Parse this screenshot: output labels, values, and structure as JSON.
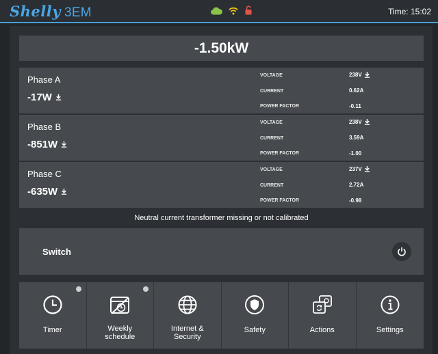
{
  "header": {
    "brand_logo": "Shelly",
    "brand_model": "3EM",
    "time": "Time: 15:02",
    "status_icons": [
      "cloud-icon",
      "wifi-icon",
      "lock-open-icon"
    ],
    "colors": {
      "brand": "#4aa6e6",
      "cloud": "#8bc34a",
      "wifi": "#f5c518",
      "lock": "#e05545"
    }
  },
  "total_power": "-1.50kW",
  "labels": {
    "voltage": "VOLTAGE",
    "current": "CURRENT",
    "power_factor": "POWER FACTOR"
  },
  "phases": [
    {
      "name": "Phase A",
      "power": "-17W",
      "voltage": "238V",
      "current": "0.62A",
      "power_factor": "-0.11"
    },
    {
      "name": "Phase B",
      "power": "-851W",
      "voltage": "238V",
      "current": "3.59A",
      "power_factor": "-1.00"
    },
    {
      "name": "Phase C",
      "power": "-635W",
      "voltage": "237V",
      "current": "2.72A",
      "power_factor": "-0.98"
    }
  ],
  "note": "Neutral current transformer missing or not calibrated",
  "switch": {
    "label": "Switch",
    "icon": "power-icon"
  },
  "tiles": [
    {
      "label": "Timer",
      "icon": "clock-icon",
      "indicator": true
    },
    {
      "label": "Weekly schedule",
      "line1": "Weekly",
      "line2": "schedule",
      "icon": "schedule-off-icon",
      "indicator": true
    },
    {
      "label": "Internet & Security",
      "line1": "Internet &",
      "line2": "Security",
      "icon": "globe-icon",
      "indicator": false
    },
    {
      "label": "Safety",
      "icon": "shield-icon",
      "indicator": false
    },
    {
      "label": "Actions",
      "icon": "actions-icon",
      "indicator": false
    },
    {
      "label": "Settings",
      "icon": "info-icon",
      "indicator": false
    }
  ]
}
